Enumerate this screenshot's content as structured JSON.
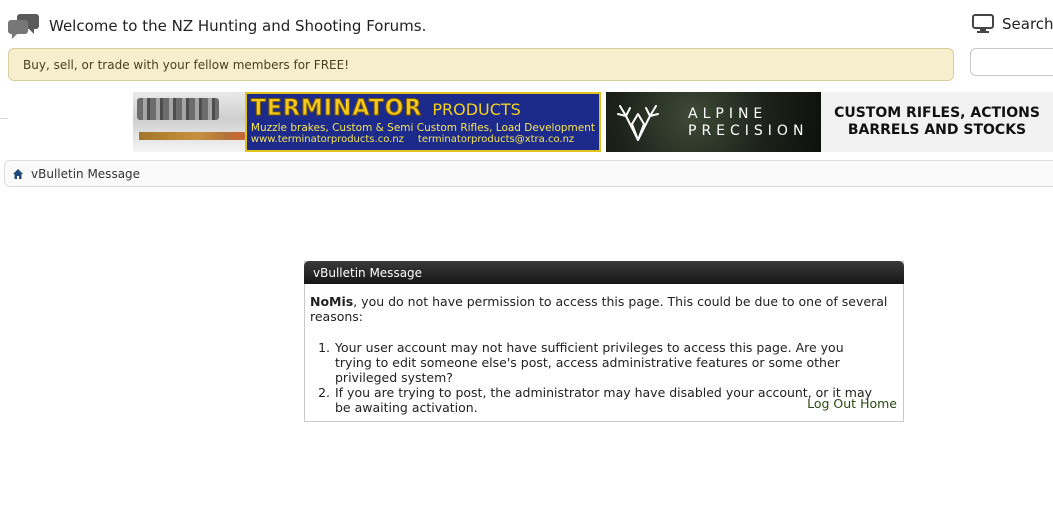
{
  "header": {
    "welcome_title": "Welcome to the NZ Hunting and Shooting Forums.",
    "search_label": "Search F"
  },
  "notice": {
    "text": "Buy, sell, or trade with your fellow members for FREE!"
  },
  "banners": {
    "terminator": {
      "word": "TERMINATOR",
      "products": "PRODUCTS",
      "tagline": "Muzzle brakes, Custom & Semi Custom Rifles, Load Development",
      "website": "www.terminatorproducts.co.nz",
      "email": "terminatorproducts@xtra.co.nz"
    },
    "alpine": {
      "name_line1": "ALPINE",
      "name_line2": "PRECISION",
      "tagline_line1": "CUSTOM RIFLES, ACTIONS",
      "tagline_line2": "BARRELS AND STOCKS"
    }
  },
  "breadcrumb": {
    "current": "vBulletin Message"
  },
  "message": {
    "heading": "vBulletin Message",
    "username": "NoMis",
    "intro": ", you do not have permission to access this page. This could be due to one of several reasons:",
    "reasons": [
      {
        "num": "1.",
        "text": "Your user account may not have sufficient privileges to access this page. Are you trying to edit someone else's post, access administrative features or some other privileged system?"
      },
      {
        "num": "2.",
        "text": "If you are trying to post, the administrator may have disabled your account, or it may be awaiting activation."
      }
    ],
    "logout_label": "Log Out",
    "home_label": "Home"
  },
  "colors": {
    "notice_bg": "#f6efce",
    "link": "#2a4b11",
    "header_bar": "#1a1a1a"
  }
}
